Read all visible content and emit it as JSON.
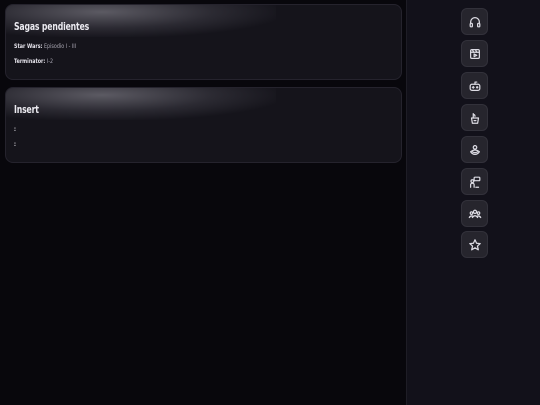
{
  "cards": [
    {
      "title": "Sagas pendientes",
      "lines": [
        {
          "key": "Star Wars:",
          "value": " Episodio I - III"
        },
        {
          "key": "Terminator:",
          "value": " I-2"
        }
      ]
    },
    {
      "title": "Insert",
      "lines": [
        {
          "key": ":",
          "value": ""
        },
        {
          "key": ":",
          "value": ""
        }
      ]
    }
  ],
  "sidebar": {
    "buttons": [
      {
        "icon": "headphones-icon"
      },
      {
        "icon": "film-icon"
      },
      {
        "icon": "gamepad-icon"
      },
      {
        "icon": "plant-pot-icon"
      },
      {
        "icon": "cake-icon"
      },
      {
        "icon": "speech-bubble-icon"
      },
      {
        "icon": "group-icon"
      },
      {
        "icon": "star-icon"
      }
    ]
  }
}
